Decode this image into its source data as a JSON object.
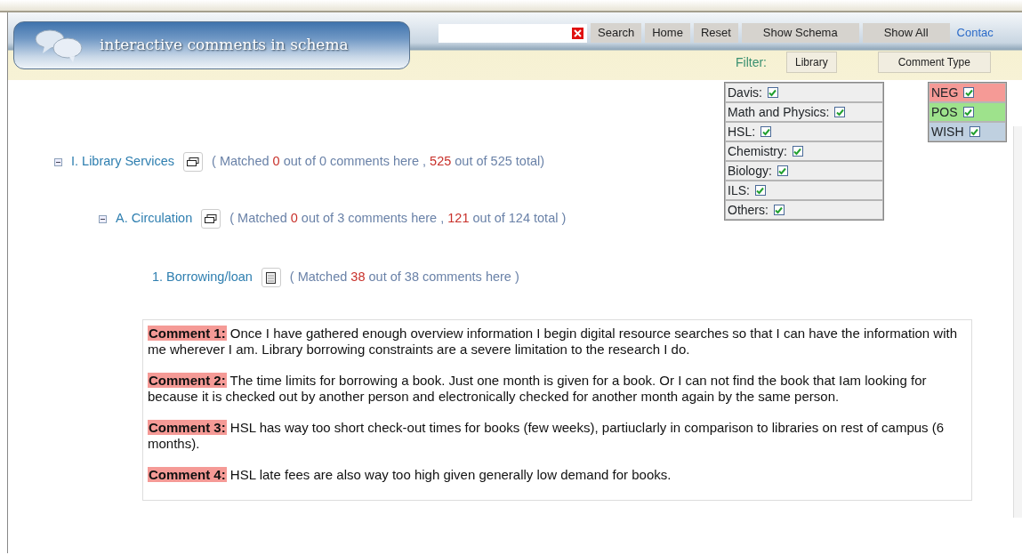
{
  "header": {
    "logo_text": "interactive comments in schema",
    "buttons": [
      "Search",
      "Home",
      "Reset",
      "Show Schema",
      "Show All"
    ],
    "contact_link": "Contac",
    "filter_label": "Filter:",
    "filter_buttons": [
      "Library",
      "Comment Type"
    ]
  },
  "library_filter": [
    {
      "label": "Davis:",
      "checked": true
    },
    {
      "label": "Math and Physics:",
      "checked": true
    },
    {
      "label": "HSL:",
      "checked": true
    },
    {
      "label": "Chemistry:",
      "checked": true
    },
    {
      "label": "Biology:",
      "checked": true
    },
    {
      "label": "ILS:",
      "checked": true
    },
    {
      "label": "Others:",
      "checked": true
    }
  ],
  "type_filter": [
    {
      "label": "NEG",
      "checked": true,
      "color": "#f59a96"
    },
    {
      "label": "POS",
      "checked": true,
      "color": "#9ee28c"
    },
    {
      "label": "WISH",
      "checked": true,
      "color": "#bfd0e0"
    }
  ],
  "tree": [
    {
      "label": "I. Library Services",
      "expanded": true,
      "stats": [
        {
          "kind": "text",
          "text": "( Matched "
        },
        {
          "kind": "count",
          "text": "0"
        },
        {
          "kind": "text",
          "text": " out of 0 comments here , "
        },
        {
          "kind": "count",
          "text": "525"
        },
        {
          "kind": "text",
          "text": " out of 525 total)"
        }
      ],
      "children": [
        {
          "label": "A. Circulation",
          "expanded": true,
          "stats": [
            {
              "kind": "text",
              "text": "( Matched "
            },
            {
              "kind": "count",
              "text": "0"
            },
            {
              "kind": "text",
              "text": " out of 3 comments here , "
            },
            {
              "kind": "count",
              "text": "121"
            },
            {
              "kind": "text",
              "text": " out of 124 total )"
            }
          ],
          "children": [
            {
              "label": "1. Borrowing/loan",
              "stats": [
                {
                  "kind": "text",
                  "text": "( Matched "
                },
                {
                  "kind": "count",
                  "text": "38"
                },
                {
                  "kind": "text",
                  "text": " out of 38 comments here )"
                }
              ]
            }
          ]
        }
      ]
    }
  ],
  "comments": [
    {
      "label": "Comment 1:",
      "text": "Once I have gathered enough overview information I begin digital resource searches so that I can have the information with me wherever I am. Library borrowing constraints are a severe limitation to the research I do."
    },
    {
      "label": "Comment 2:",
      "text": "The time limits for borrowing a book. Just one month is given for a book. Or I can not find the book that Iam looking for because it is checked out by another person and electronically checked for another month again by the same person."
    },
    {
      "label": "Comment 3:",
      "text": "HSL has way too short check-out times for books (few weeks), partiuclarly in comparison to libraries on rest of campus (6 months)."
    },
    {
      "label": "Comment 4:",
      "text": "HSL late fees are also way too high given generally low demand for books."
    }
  ]
}
